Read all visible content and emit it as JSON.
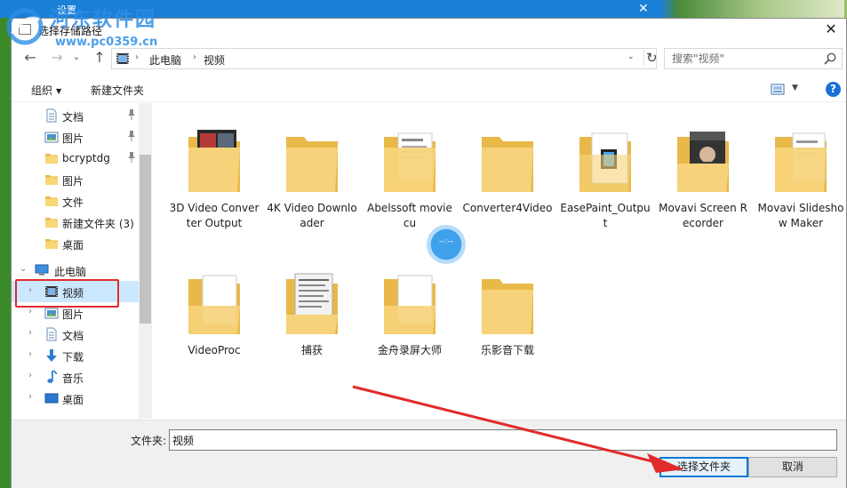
{
  "background": {
    "window_title": "设置",
    "close_glyph": "✕"
  },
  "dialog": {
    "title": "选择存储路径",
    "close_glyph": "✕"
  },
  "nav": {
    "back": "←",
    "forward": "→",
    "recent": "⌄",
    "up": "↑"
  },
  "address": {
    "sep": "›",
    "crumbs": [
      "此电脑",
      "视频"
    ],
    "dropdown": "⌄",
    "refresh": "↻"
  },
  "search": {
    "placeholder": "搜索\"视频\""
  },
  "toolbar": {
    "organize": "组织",
    "organize_arrow": "▼",
    "new_folder": "新建文件夹",
    "view_arrow": "▼",
    "help": "?"
  },
  "sidebar": {
    "expand_glyph": "›",
    "expanded_glyph": "⌄",
    "pin_glyph": "📌",
    "items": [
      {
        "label": "文档",
        "icon": "document-icon",
        "pinned": true
      },
      {
        "label": "图片",
        "icon": "pictures-icon",
        "pinned": true
      },
      {
        "label": "bcryptdg",
        "icon": "folder-icon",
        "pinned": true
      },
      {
        "label": "图片",
        "icon": "folder-icon",
        "pinned": false
      },
      {
        "label": "文件",
        "icon": "folder-icon",
        "pinned": false
      },
      {
        "label": "新建文件夹 (3)",
        "icon": "folder-icon",
        "pinned": false
      },
      {
        "label": "桌面",
        "icon": "folder-icon",
        "pinned": false
      },
      {
        "label": "此电脑",
        "icon": "computer-icon",
        "pinned": false
      },
      {
        "label": "视频",
        "icon": "video-icon",
        "pinned": false
      },
      {
        "label": "图片",
        "icon": "pictures-icon",
        "pinned": false
      },
      {
        "label": "文档",
        "icon": "document-icon",
        "pinned": false
      },
      {
        "label": "下载",
        "icon": "download-icon",
        "pinned": false
      },
      {
        "label": "音乐",
        "icon": "music-icon",
        "pinned": false
      },
      {
        "label": "桌面",
        "icon": "desktop-icon",
        "pinned": false
      }
    ]
  },
  "files": [
    {
      "name": "3D Video Converter Output",
      "thumb": "video-thumb"
    },
    {
      "name": "4K Video Downloader",
      "thumb": "plain"
    },
    {
      "name": "Abelssoft moviecu",
      "thumb": "document"
    },
    {
      "name": "Converter4Video",
      "thumb": "plain"
    },
    {
      "name": "EasePaint_Output",
      "thumb": "media"
    },
    {
      "name": "Movavi Screen Recorder",
      "thumb": "photo"
    },
    {
      "name": "Movavi Slideshow Maker",
      "thumb": "document"
    },
    {
      "name": "VideoProc",
      "thumb": "blank"
    },
    {
      "name": "捕获",
      "thumb": "screenshot"
    },
    {
      "name": "金舟录屏大师",
      "thumb": "blank"
    },
    {
      "name": "乐影音下载",
      "thumb": "plain"
    }
  ],
  "loading": {
    "text": "--:--"
  },
  "bottom": {
    "folder_label": "文件夹:",
    "folder_value": "视频",
    "select_button": "选择文件夹",
    "cancel_button": "取消"
  },
  "watermark": {
    "name": "河东软件园",
    "url": "www.pc0359.cn"
  },
  "colors": {
    "accent": "#0078d7",
    "selection": "#cce8ff",
    "annotation_red": "#e12b2b",
    "folder_yellow": "#f6d37a"
  }
}
